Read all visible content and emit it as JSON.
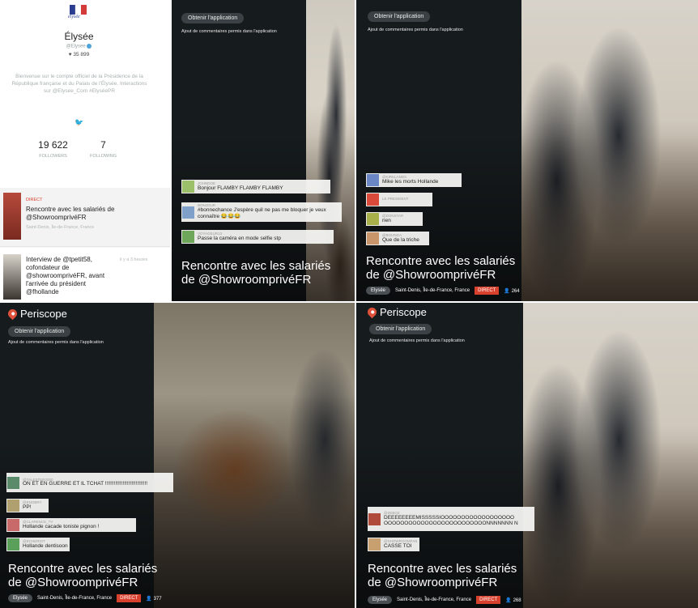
{
  "profile": {
    "logo_text": "élysée",
    "name": "Élysée",
    "handle": "@Elysee",
    "hearts": "35 899",
    "bio": "Bienvenue sur le compte officiel de la Présidence de la République française et du Palais de l'Élysée. Interactions sur @Elysee_Com #ElyséePR",
    "followers_count": "19 622",
    "followers_label": "FOLLOWERS",
    "following_count": "7",
    "following_label": "FOLLOWING",
    "broadcasts": [
      {
        "status": "DIRECT",
        "title": "Rencontre avec les salariés de @ShowroomprivéFR",
        "meta": "Saint-Denis, Île-de-France, France"
      },
      {
        "status": "",
        "title": "Interview de @tpetit58, cofondateur de @showroomprivéFR, avant l'arrivée du président @fhollande",
        "meta": "il y a 3 heures"
      }
    ]
  },
  "common": {
    "app_button": "Obtenir l'application",
    "comments_note": "Ajout de commentaires permis dans l'application",
    "broadcast_title_line1": "Rencontre avec les salariés",
    "broadcast_title_line2": "de @ShowroomprivéFR",
    "host_tag": "Elysée",
    "location": "Saint-Denis, Île-de-France, France",
    "live_label": "DIRECT",
    "periscope_brand": "Periscope"
  },
  "panels": [
    {
      "id": "top-middle",
      "comments": [
        {
          "user": "JOHNDOE",
          "text": "Bonjour FLAMBY FLAMBY FLAMBY",
          "color": "#9cbf6a"
        },
        {
          "user": "BONJOUR",
          "text": "#bonnechance J'espère quil ne pas me bloquer je veux connaître 😂😂😂",
          "color": "#7fa0c8"
        },
        {
          "user": "VOYAGEUR13",
          "text": "Passe la caméra en mode selfie stp",
          "color": "#6ea65a"
        }
      ]
    },
    {
      "id": "top-right",
      "viewers": "264",
      "comments": [
        {
          "user": "@KIRKLANDX",
          "text": "Mike les morts Hollande",
          "color": "#6a86c4"
        },
        {
          "user": "LE PRESIDENT",
          "text": "",
          "color": "#d94a3a"
        },
        {
          "user": "@DONSTAR",
          "text": "rien",
          "color": "#a8b04a"
        },
        {
          "user": "@BOUNGA",
          "text": "Que de la triche",
          "color": "#c8956a"
        }
      ]
    },
    {
      "id": "bottom-left",
      "viewers": "377",
      "comments": [
        {
          "user": "@TALESTER2000",
          "text": "ON ET EN GUERRE ET IL TCHAT !!!!!!!!!!!!!!!!!!!!!!!!!!!!!",
          "color": "#5a8a6a"
        },
        {
          "user": "@ENOBRY",
          "text": "PP!",
          "color": "#b0a070"
        },
        {
          "user": "@CLARENCE_TV",
          "text": "Hollande cacade toniste pignon !",
          "color": "#c86a6a"
        },
        {
          "user": "@ECHERIOT",
          "text": "Hollande dentisoon",
          "color": "#5aa05a"
        }
      ]
    },
    {
      "id": "bottom-right",
      "viewers": "268",
      "comments": [
        {
          "user": "@ZEBOZ",
          "text": "DEEEEEEEEMISSSSSIOOOOOOOOOOOOOOOOOO OOOOOOOOOOOOOOOOOOOOOOOOONNNNNNN N",
          "color": "#b04a3a"
        },
        {
          "user": "@SHOWROOMFAN",
          "text": "CASSE TOI",
          "color": "#c8a070"
        }
      ]
    }
  ]
}
